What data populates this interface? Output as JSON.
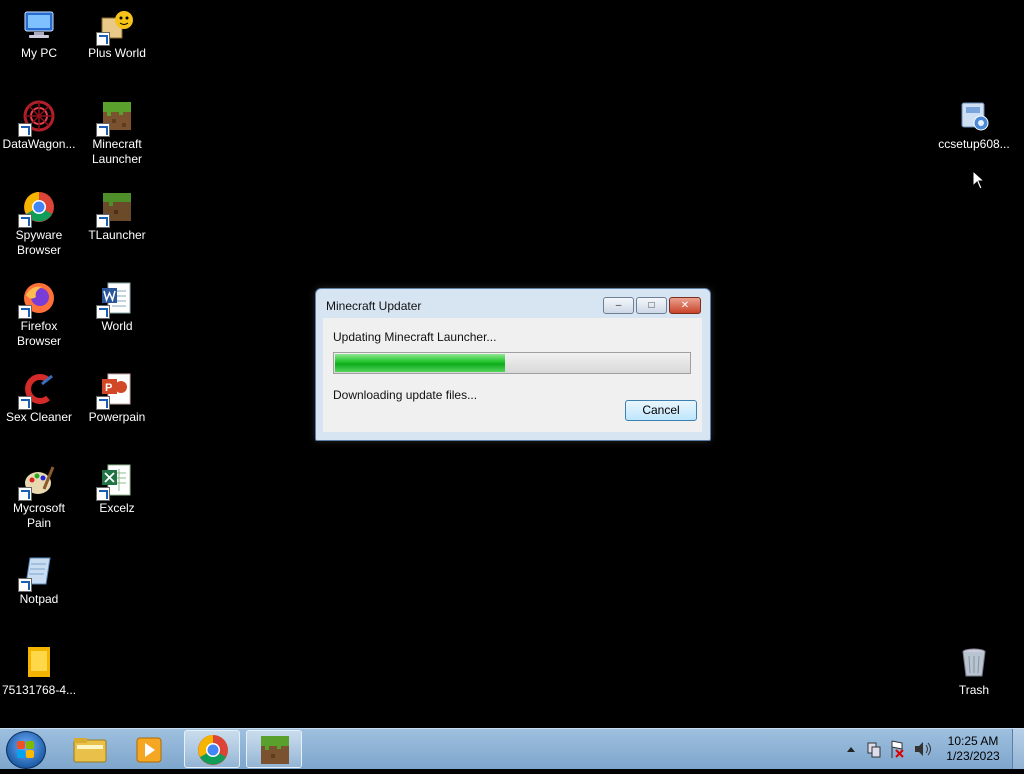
{
  "desktop": {
    "icons": [
      {
        "label": "My PC"
      },
      {
        "label": "Plus World"
      },
      {
        "label": "DataWagon..."
      },
      {
        "label": "Minecraft Launcher"
      },
      {
        "label": "Spyware Browser"
      },
      {
        "label": "TLauncher"
      },
      {
        "label": "Firefox Browser"
      },
      {
        "label": "World"
      },
      {
        "label": "Sex Cleaner"
      },
      {
        "label": "Powerpain"
      },
      {
        "label": "Mycrosoft Pain"
      },
      {
        "label": "Excelz"
      },
      {
        "label": "Notpad"
      },
      {
        "label": "75131768-4..."
      },
      {
        "label": "ccsetup608..."
      },
      {
        "label": "Trash"
      }
    ]
  },
  "dialog": {
    "title": "Minecraft Updater",
    "status_text": "Updating Minecraft Launcher...",
    "detail_text": "Downloading update files...",
    "progress_fraction": 0.48,
    "cancel_label": "Cancel",
    "min_glyph": "–",
    "max_glyph": "□",
    "close_glyph": "✕"
  },
  "taskbar": {
    "clock_time": "10:25 AM",
    "clock_date": "1/23/2023",
    "pinned": [
      "file-explorer-icon",
      "media-player-icon",
      "chrome-icon",
      "minecraft-icon"
    ]
  },
  "colors": {
    "progress_green": "#1fc42a",
    "taskbar": "#8fb3d8",
    "desktop_background": "#000000"
  }
}
